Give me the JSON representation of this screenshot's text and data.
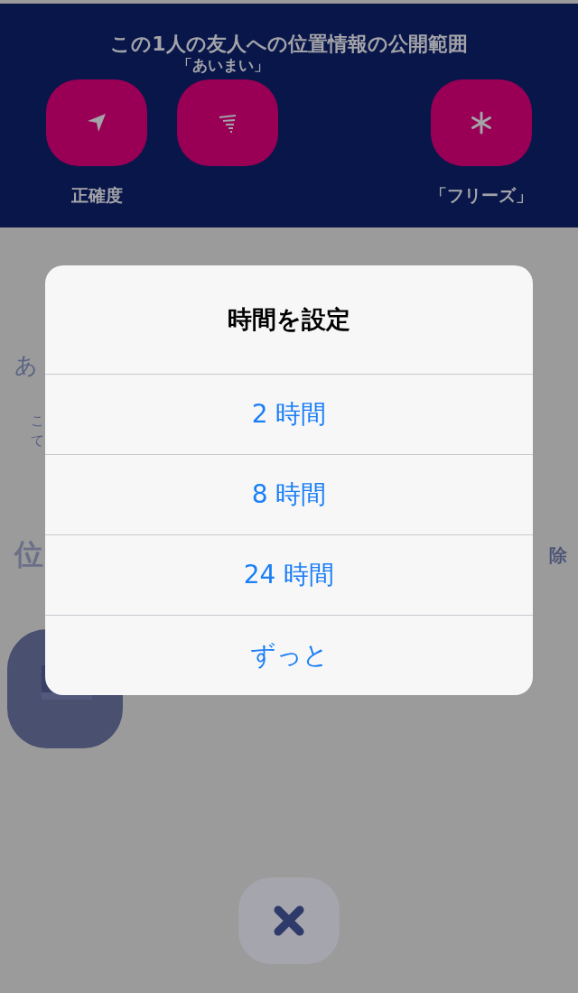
{
  "header": {
    "title": "この1人の友人への位置情報の公開範囲",
    "subtitle": "「あいまい」",
    "buttons": [
      {
        "kind": "arrow",
        "label": "正確度"
      },
      {
        "kind": "fuzzy"
      },
      {
        "kind": "snowflake",
        "label": "「フリーズ」"
      }
    ]
  },
  "background": {
    "heading": "あ",
    "note_lines": [
      "こ",
      "て"
    ],
    "section_title": "位",
    "section_action": "除",
    "avatar": {
      "kind": "picture"
    }
  },
  "dialog": {
    "title": "時間を設定",
    "options": [
      "2 時間",
      "8 時間",
      "24 時間",
      "ずっと"
    ]
  },
  "close_button": {
    "kind": "close"
  }
}
